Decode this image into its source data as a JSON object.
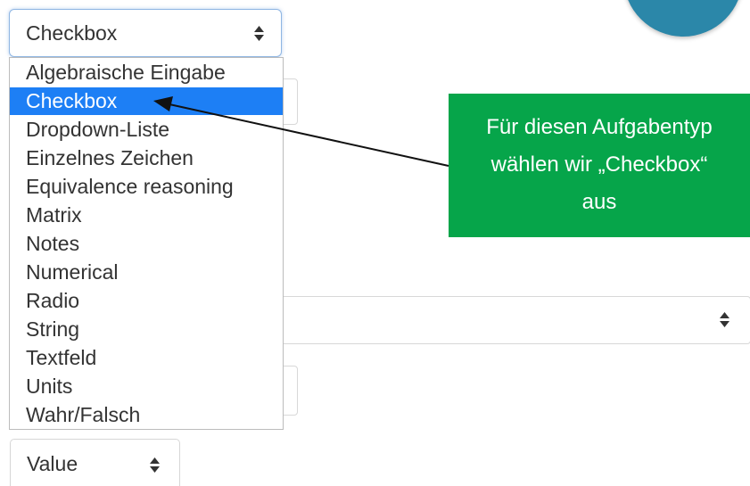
{
  "question_type_select": {
    "value": "Checkbox",
    "icon": "updown-chevron-icon"
  },
  "dropdown": {
    "selected_index": 1,
    "options": [
      "Algebraische Eingabe",
      "Checkbox",
      "Dropdown-Liste",
      "Einzelnes Zeichen",
      "Equivalence reasoning",
      "Matrix",
      "Notes",
      "Numerical",
      "Radio",
      "String",
      "Textfeld",
      "Units",
      "Wahr/Falsch"
    ]
  },
  "callout": {
    "line1": "Für diesen Aufgabentyp",
    "line2": "wählen wir „Checkbox“",
    "line3": "aus"
  },
  "value_select": {
    "value": "Value",
    "icon": "updown-chevron-icon"
  },
  "colors": {
    "highlight": "#1d7ff5",
    "callout_green": "#06a54a",
    "circle_teal": "#2b87a9",
    "focus_border": "#8fb6e3"
  }
}
